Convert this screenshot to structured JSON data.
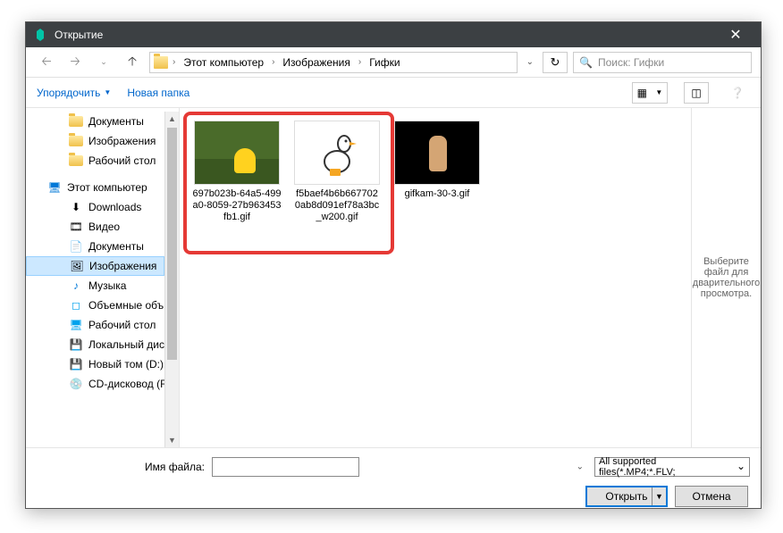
{
  "title": "Открытие",
  "breadcrumbs": {
    "root": "Этот компьютер",
    "mid": "Изображения",
    "leaf": "Гифки"
  },
  "search": {
    "placeholder": "Поиск: Гифки"
  },
  "toolbar": {
    "organize": "Упорядочить",
    "newfolder": "Новая папка"
  },
  "sidebar": {
    "items": [
      {
        "label": "Документы",
        "icon": "folder"
      },
      {
        "label": "Изображения",
        "icon": "folder"
      },
      {
        "label": "Рабочий стол",
        "icon": "folder"
      },
      {
        "label": "Этот компьютер",
        "icon": "pc",
        "top": true
      },
      {
        "label": "Downloads",
        "icon": "downloads"
      },
      {
        "label": "Видео",
        "icon": "video"
      },
      {
        "label": "Документы",
        "icon": "docs"
      },
      {
        "label": "Изображения",
        "icon": "images",
        "selected": true
      },
      {
        "label": "Музыка",
        "icon": "music"
      },
      {
        "label": "Объемные объ",
        "icon": "3d"
      },
      {
        "label": "Рабочий стол",
        "icon": "desktop"
      },
      {
        "label": "Локальный дис",
        "icon": "disk"
      },
      {
        "label": "Новый том (D:)",
        "icon": "disk"
      },
      {
        "label": "CD-дисковод (F",
        "icon": "cd"
      }
    ]
  },
  "files": [
    {
      "name": "697b023b-64a5-499a0-8059-27b963453fb1.gif",
      "thumb": "simpsons"
    },
    {
      "name": "f5baef4b6b667702\n0ab8d091ef78a3bc_w200.gif",
      "thumb": "goose"
    },
    {
      "name": "gifkam-30-3.gif",
      "thumb": "baby"
    }
  ],
  "preview": {
    "text": "Выберите файл для дварительного просмотра."
  },
  "bottom": {
    "filename_label": "Имя файла:",
    "filename_value": "",
    "filter": "All supported files(*.MP4;*.FLV;",
    "open": "Открыть",
    "cancel": "Отмена"
  }
}
